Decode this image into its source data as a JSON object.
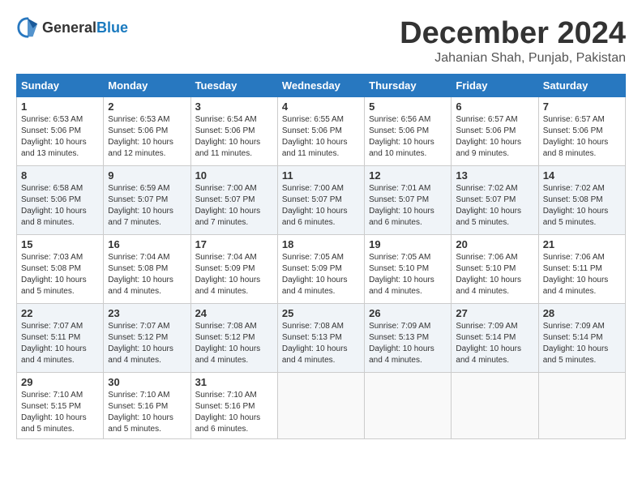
{
  "header": {
    "logo_general": "General",
    "logo_blue": "Blue",
    "month": "December 2024",
    "location": "Jahanian Shah, Punjab, Pakistan"
  },
  "days_of_week": [
    "Sunday",
    "Monday",
    "Tuesday",
    "Wednesday",
    "Thursday",
    "Friday",
    "Saturday"
  ],
  "weeks": [
    [
      {
        "day": "1",
        "info": "Sunrise: 6:53 AM\nSunset: 5:06 PM\nDaylight: 10 hours\nand 13 minutes."
      },
      {
        "day": "2",
        "info": "Sunrise: 6:53 AM\nSunset: 5:06 PM\nDaylight: 10 hours\nand 12 minutes."
      },
      {
        "day": "3",
        "info": "Sunrise: 6:54 AM\nSunset: 5:06 PM\nDaylight: 10 hours\nand 11 minutes."
      },
      {
        "day": "4",
        "info": "Sunrise: 6:55 AM\nSunset: 5:06 PM\nDaylight: 10 hours\nand 11 minutes."
      },
      {
        "day": "5",
        "info": "Sunrise: 6:56 AM\nSunset: 5:06 PM\nDaylight: 10 hours\nand 10 minutes."
      },
      {
        "day": "6",
        "info": "Sunrise: 6:57 AM\nSunset: 5:06 PM\nDaylight: 10 hours\nand 9 minutes."
      },
      {
        "day": "7",
        "info": "Sunrise: 6:57 AM\nSunset: 5:06 PM\nDaylight: 10 hours\nand 8 minutes."
      }
    ],
    [
      {
        "day": "8",
        "info": "Sunrise: 6:58 AM\nSunset: 5:06 PM\nDaylight: 10 hours\nand 8 minutes."
      },
      {
        "day": "9",
        "info": "Sunrise: 6:59 AM\nSunset: 5:07 PM\nDaylight: 10 hours\nand 7 minutes."
      },
      {
        "day": "10",
        "info": "Sunrise: 7:00 AM\nSunset: 5:07 PM\nDaylight: 10 hours\nand 7 minutes."
      },
      {
        "day": "11",
        "info": "Sunrise: 7:00 AM\nSunset: 5:07 PM\nDaylight: 10 hours\nand 6 minutes."
      },
      {
        "day": "12",
        "info": "Sunrise: 7:01 AM\nSunset: 5:07 PM\nDaylight: 10 hours\nand 6 minutes."
      },
      {
        "day": "13",
        "info": "Sunrise: 7:02 AM\nSunset: 5:07 PM\nDaylight: 10 hours\nand 5 minutes."
      },
      {
        "day": "14",
        "info": "Sunrise: 7:02 AM\nSunset: 5:08 PM\nDaylight: 10 hours\nand 5 minutes."
      }
    ],
    [
      {
        "day": "15",
        "info": "Sunrise: 7:03 AM\nSunset: 5:08 PM\nDaylight: 10 hours\nand 5 minutes."
      },
      {
        "day": "16",
        "info": "Sunrise: 7:04 AM\nSunset: 5:08 PM\nDaylight: 10 hours\nand 4 minutes."
      },
      {
        "day": "17",
        "info": "Sunrise: 7:04 AM\nSunset: 5:09 PM\nDaylight: 10 hours\nand 4 minutes."
      },
      {
        "day": "18",
        "info": "Sunrise: 7:05 AM\nSunset: 5:09 PM\nDaylight: 10 hours\nand 4 minutes."
      },
      {
        "day": "19",
        "info": "Sunrise: 7:05 AM\nSunset: 5:10 PM\nDaylight: 10 hours\nand 4 minutes."
      },
      {
        "day": "20",
        "info": "Sunrise: 7:06 AM\nSunset: 5:10 PM\nDaylight: 10 hours\nand 4 minutes."
      },
      {
        "day": "21",
        "info": "Sunrise: 7:06 AM\nSunset: 5:11 PM\nDaylight: 10 hours\nand 4 minutes."
      }
    ],
    [
      {
        "day": "22",
        "info": "Sunrise: 7:07 AM\nSunset: 5:11 PM\nDaylight: 10 hours\nand 4 minutes."
      },
      {
        "day": "23",
        "info": "Sunrise: 7:07 AM\nSunset: 5:12 PM\nDaylight: 10 hours\nand 4 minutes."
      },
      {
        "day": "24",
        "info": "Sunrise: 7:08 AM\nSunset: 5:12 PM\nDaylight: 10 hours\nand 4 minutes."
      },
      {
        "day": "25",
        "info": "Sunrise: 7:08 AM\nSunset: 5:13 PM\nDaylight: 10 hours\nand 4 minutes."
      },
      {
        "day": "26",
        "info": "Sunrise: 7:09 AM\nSunset: 5:13 PM\nDaylight: 10 hours\nand 4 minutes."
      },
      {
        "day": "27",
        "info": "Sunrise: 7:09 AM\nSunset: 5:14 PM\nDaylight: 10 hours\nand 4 minutes."
      },
      {
        "day": "28",
        "info": "Sunrise: 7:09 AM\nSunset: 5:14 PM\nDaylight: 10 hours\nand 5 minutes."
      }
    ],
    [
      {
        "day": "29",
        "info": "Sunrise: 7:10 AM\nSunset: 5:15 PM\nDaylight: 10 hours\nand 5 minutes."
      },
      {
        "day": "30",
        "info": "Sunrise: 7:10 AM\nSunset: 5:16 PM\nDaylight: 10 hours\nand 5 minutes."
      },
      {
        "day": "31",
        "info": "Sunrise: 7:10 AM\nSunset: 5:16 PM\nDaylight: 10 hours\nand 6 minutes."
      },
      {
        "day": "",
        "info": ""
      },
      {
        "day": "",
        "info": ""
      },
      {
        "day": "",
        "info": ""
      },
      {
        "day": "",
        "info": ""
      }
    ]
  ]
}
